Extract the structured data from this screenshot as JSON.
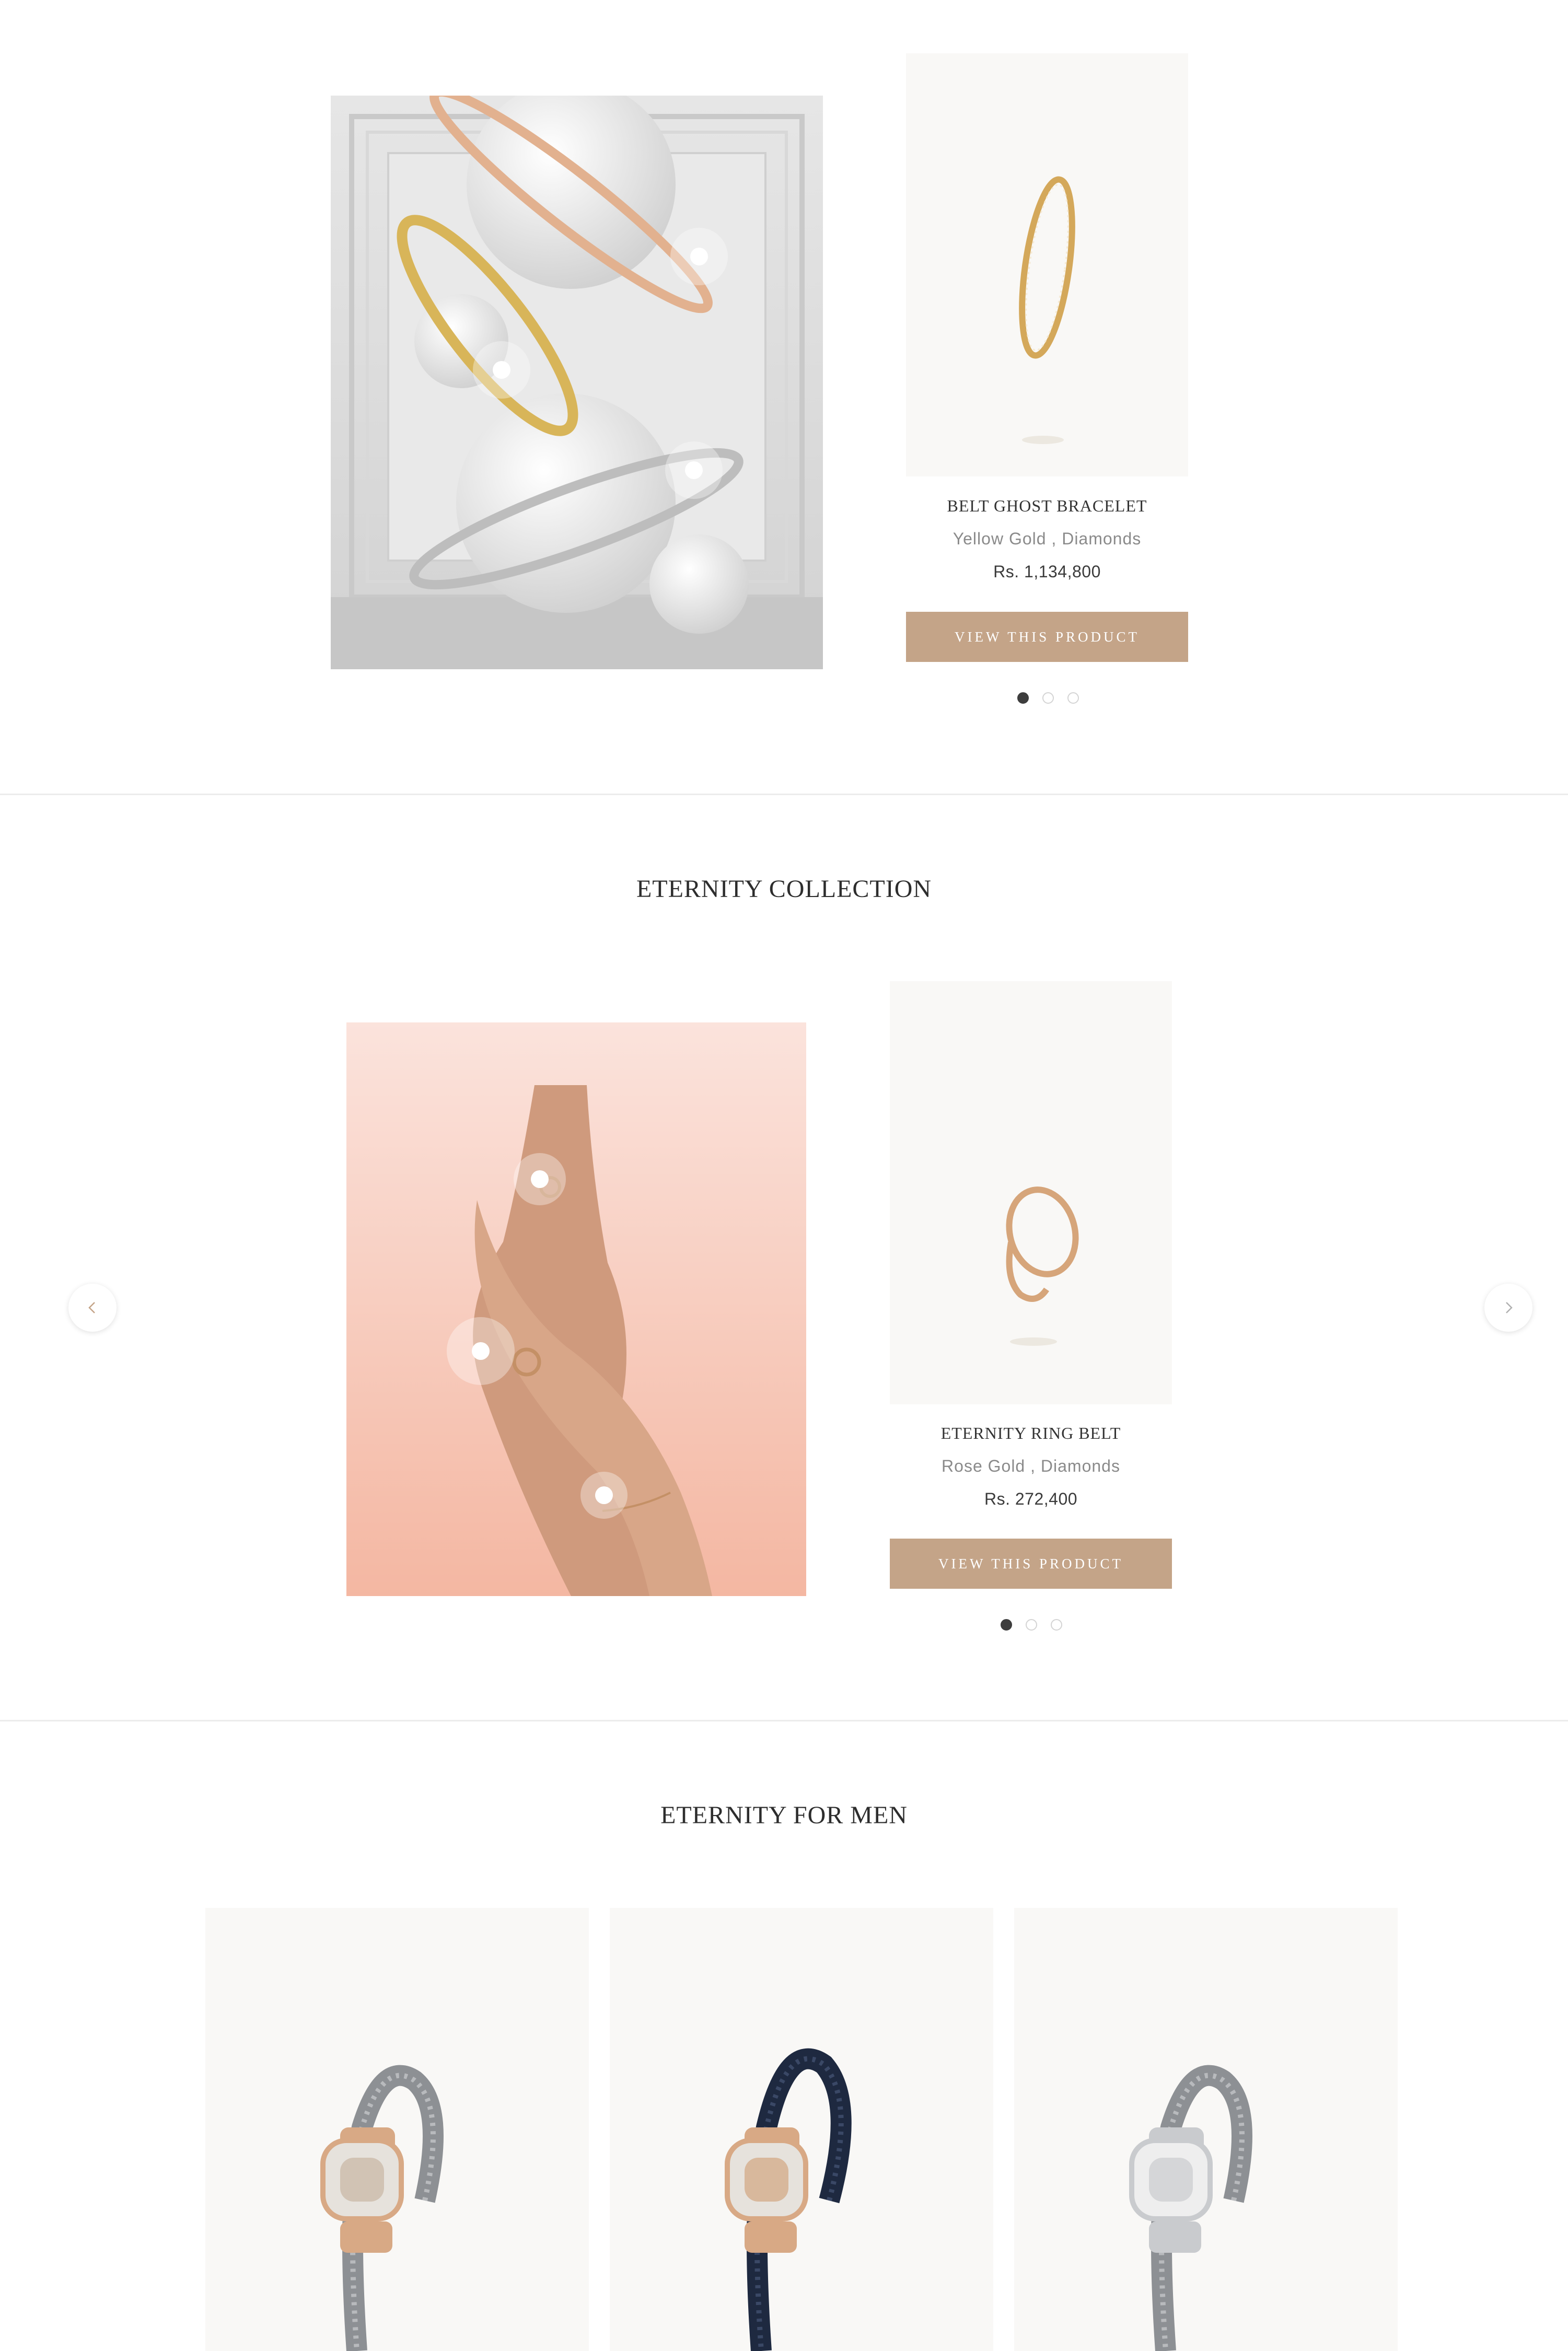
{
  "featured": {
    "product": {
      "name": "BELT GHOST BRACELET",
      "material": "Yellow Gold , Diamonds",
      "price": "Rs. 1,134,800",
      "button_label": "VIEW THIS PRODUCT"
    },
    "carousel": {
      "slides": 3,
      "active": 1
    },
    "lifestyle_icon": "stacked-bangles-image"
  },
  "eternity_collection": {
    "title": "ETERNITY COLLECTION",
    "product": {
      "name": "ETERNITY RING BELT",
      "material": "Rose Gold , Diamonds",
      "price": "Rs. 272,400",
      "button_label": "VIEW THIS PRODUCT"
    },
    "carousel": {
      "slides": 3,
      "active": 1
    },
    "lifestyle_icon": "hands-with-rings-image",
    "prev_icon": "chevron-left-icon",
    "next_icon": "chevron-right-icon"
  },
  "eternity_for_men": {
    "title": "ETERNITY FOR MEN",
    "products": [
      {
        "icon": "grey-cable-rose-gold-bracelet",
        "cable_color": "#8d9094",
        "clasp_color": "#d8a985"
      },
      {
        "icon": "navy-cable-rose-gold-bracelet",
        "cable_color": "#1e2940",
        "clasp_color": "#d8a985"
      },
      {
        "icon": "grey-cable-white-gold-bracelet",
        "cable_color": "#8d9094",
        "clasp_color": "#c9cbce"
      }
    ]
  },
  "colors": {
    "accent": "#c4a488",
    "panel": "#f9f8f6",
    "title": "#2d2d2d"
  }
}
